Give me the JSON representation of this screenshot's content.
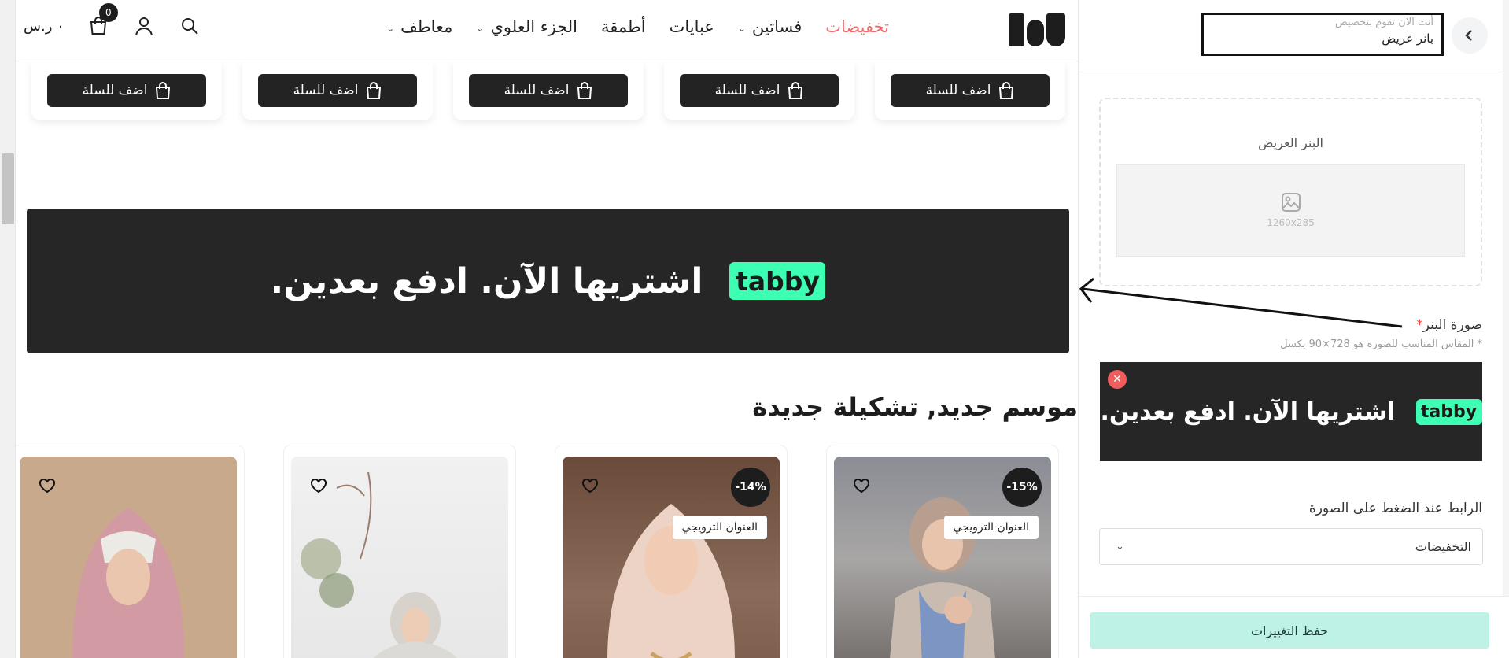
{
  "header": {
    "logo_text": "لنو",
    "nav": [
      {
        "label": "تخفيضات",
        "has_chevron": false,
        "highlight": true
      },
      {
        "label": "فساتين",
        "has_chevron": true
      },
      {
        "label": "عبايات",
        "has_chevron": false
      },
      {
        "label": "أطمقة",
        "has_chevron": false
      },
      {
        "label": "الجزء العلوي",
        "has_chevron": true
      },
      {
        "label": "معاطف",
        "has_chevron": true
      }
    ],
    "cart_total": "٠ ر.س",
    "cart_count": "0",
    "icons": [
      "search-icon",
      "user-icon",
      "cart-icon"
    ]
  },
  "add_to_cart_label": "اضف للسلة",
  "banner": {
    "text": "اشتريها الآن. ادفع بعدين.",
    "logo": "tabby",
    "bg_color": "#262626",
    "accent": "#3cffb3"
  },
  "section_title": "موسم جديد, تشكيلة جديدة",
  "products": [
    {
      "discount": "-15%",
      "promo": "العنوان الترويجي"
    },
    {
      "discount": "-14%",
      "promo": "العنوان الترويجي"
    },
    {
      "discount": "",
      "promo": ""
    },
    {
      "discount": "",
      "promo": ""
    }
  ],
  "panel": {
    "customizing_label": "أنت الآن تقوم بتخصيص",
    "customizing_value": "بانر عريض",
    "dropzone_title": "البنر العريض",
    "dropzone_size": "1260x285",
    "image_label": "صورة البنر",
    "required_mark": "*",
    "image_hint": "* المقاس المناسب للصورة هو 728×90 بكسل",
    "preview_text": "اشتريها الآن. ادفع بعدين.",
    "link_label": "الرابط عند الضغط على الصورة",
    "link_value": "التخفيضات",
    "save_label": "حفظ التغييرات"
  }
}
